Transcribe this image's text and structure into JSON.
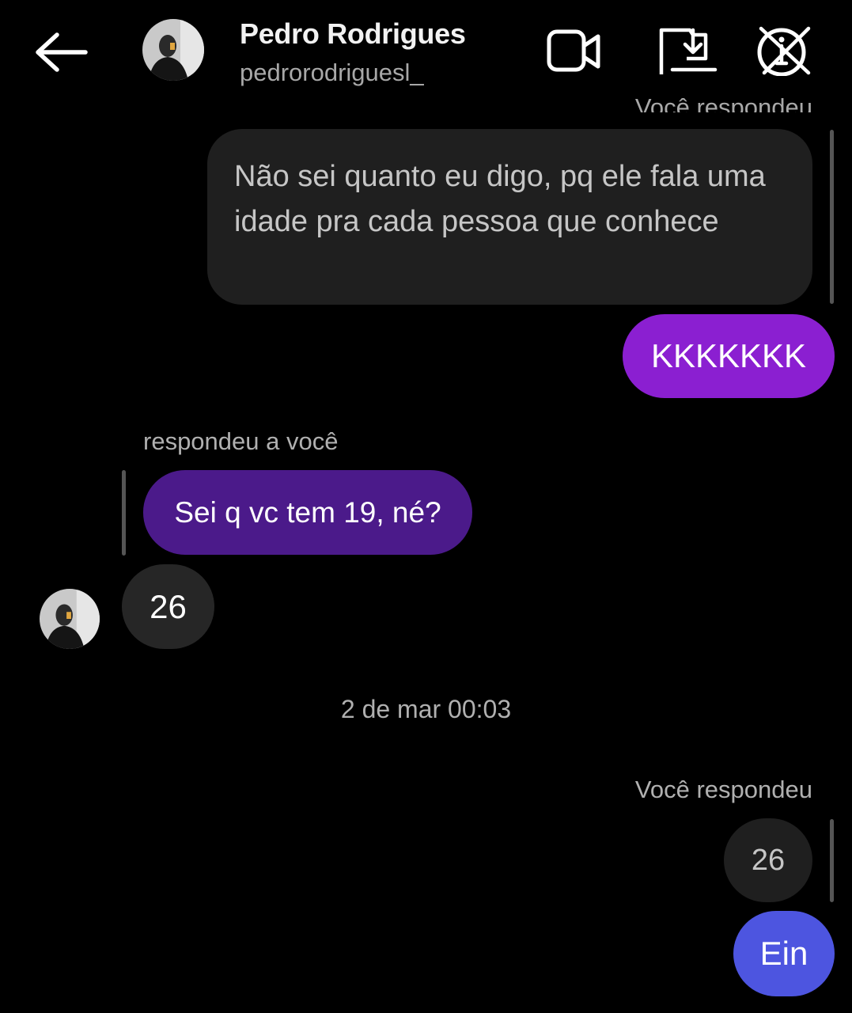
{
  "header": {
    "contact_name": "Pedro Rodrigues",
    "username": "pedrorodriguesl_",
    "icons": [
      "back-arrow-icon",
      "video-call-icon",
      "flag-download-icon",
      "info-icon"
    ]
  },
  "conversation": {
    "cut_off_label": "Você respondeu",
    "quoted_message": "Não sei quanto eu digo, pq ele fala uma idade pra cada pessoa que conhece",
    "sent_message_1": "KKKKKKK",
    "replied_to_you_label": "respondeu a você",
    "quoted_reply": "Sei q vc tem 19, né?",
    "received_message": "26",
    "timestamp": "2 de mar 00:03",
    "you_replied_label": "Você respondeu",
    "quoted_own": "26",
    "sent_message_2": "Ein"
  },
  "colors": {
    "background": "#000000",
    "sent_bubble_purple": "#8b1fd1",
    "quoted_purple": "#4b1a8a",
    "sent_bubble_blue": "#4d55e0",
    "received_bubble": "#262626",
    "quoted_bubble": "#1f1f1f"
  }
}
